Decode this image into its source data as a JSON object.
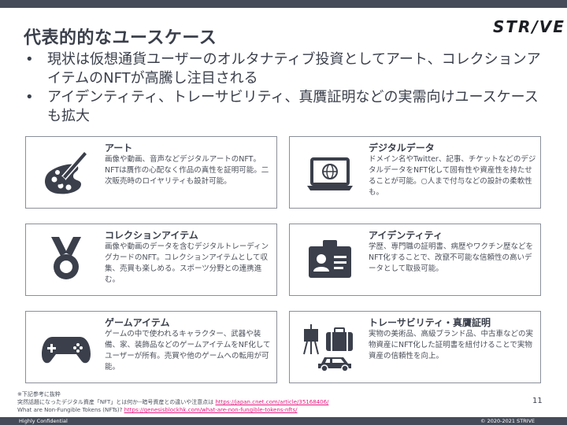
{
  "title": "代表的的なユースケース",
  "logo": "STR/VE",
  "bullets": [
    "現状は仮想通貨ユーザーのオルタナティブ投資としてアート、コレクションアイテムのNFTが高騰し注目される",
    "アイデンティティ、トレーサビリティ、真贋証明などの実需向けユースケースも拡大"
  ],
  "bullet_marker": "•",
  "cards": [
    {
      "heading": "アート",
      "desc": "画像や動画、音声などデジタルアートのNFT。NFTは贋作の心配なく作品の真性を証明可能。二次販売時のロイヤリティも設計可能。",
      "icon": "paintbrush-palette-icon"
    },
    {
      "heading": "デジタルデータ",
      "desc": "ドメイン名やTwitter、記事、チケットなどのデジタルデータをNFT化して固有性や資産性を持たせることが可能。○人まで付与などの設計の柔軟性も。",
      "icon": "laptop-globe-icon"
    },
    {
      "heading": "コレクションアイテム",
      "desc": "画像や動画のデータを含むデジタルトレーディングカードのNFT。コレクションアイテムとして収集、売買も楽しめる。スポーツ分野との連携進む。",
      "icon": "medal-icon"
    },
    {
      "heading": "アイデンティティ",
      "desc": "学歴、専門職の証明書、病歴やワクチン歴などをNFT化することで、改竄不可能な信頼性の高いデータとして取扱可能。",
      "icon": "id-card-icon"
    },
    {
      "heading": "ゲームアイテム",
      "desc": "ゲームの中で使われるキャラクター、武器や装備、家、装飾品などのゲームアイテムをNF化してユーザーが所有。売買や他のゲームへの転用が可能。",
      "icon": "gamepad-icon"
    },
    {
      "heading": "トレーサビリティ・真贋証明",
      "desc": "実物の美術品、高級ブランド品、中古車などの実物資産にNFT化した証明書を紐付けることで実物資産の信頼性を向上。",
      "icon": "easel-bag-car-icon"
    }
  ],
  "notes": {
    "line1": "※下記参考に抜粋",
    "line2_text": "突然話題になったデジタル資産「NFT」とは何か--暗号資産との違いや注意点は",
    "line2_link": "https://japan.cnet.com/article/35168406/",
    "line3_text": "What are Non-Fungible Tokens (NFTs)?",
    "line3_link": "https://genesisblockhk.com/what-are-non-fungible-tokens-nfts/"
  },
  "page_number": "11",
  "footer": {
    "left": "Highly Confidential",
    "right": "© 2020-2021 STRIVE"
  },
  "colors": {
    "bar": "#454b58",
    "text": "#3a3f4b",
    "link": "#e6197f"
  }
}
